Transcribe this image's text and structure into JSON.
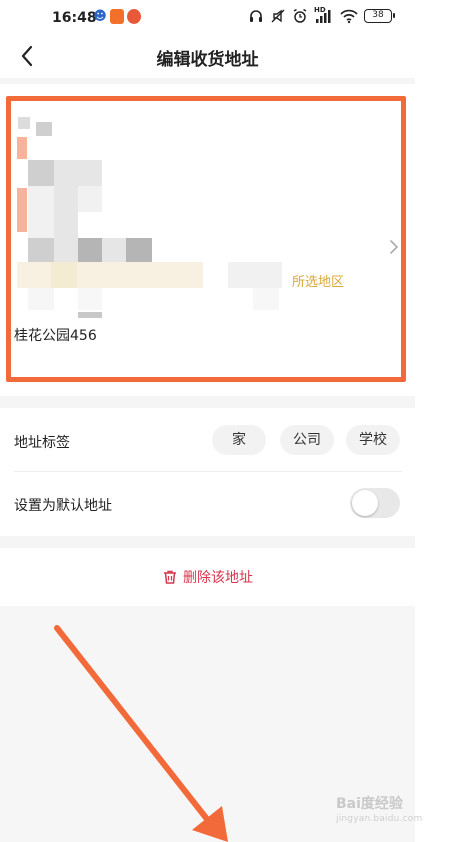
{
  "status_bar": {
    "time": "16:48",
    "battery": "38",
    "signal_label": "HD"
  },
  "header": {
    "title": "编辑收货地址"
  },
  "address": {
    "region_hint": "所选地区",
    "detail": "桂花公园456"
  },
  "settings": {
    "tag_label": "地址标签",
    "tags": [
      "家",
      "公司",
      "学校"
    ],
    "default_label": "设置为默认地址",
    "default_enabled": false
  },
  "actions": {
    "delete_label": "删除该地址"
  },
  "colors": {
    "annotation": "#f26a3a",
    "delete": "#d9354e",
    "hint": "#d9a83a"
  },
  "watermark": {
    "brand": "Bai度经验",
    "url": "jingyan.baidu.com"
  }
}
